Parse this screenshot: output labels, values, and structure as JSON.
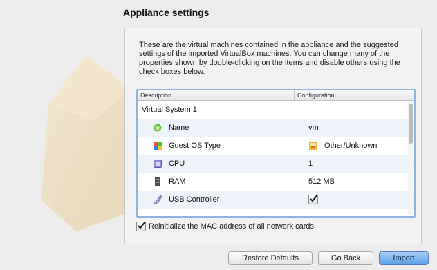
{
  "page": {
    "title": "Appliance settings",
    "description": "These are the virtual machines contained in the appliance and the suggested settings of the imported VirtualBox machines. You can change many of the properties shown by double-clicking on the items and disable others using the check boxes below."
  },
  "table": {
    "columns": [
      "Description",
      "Configuration"
    ],
    "system": "Virtual System 1",
    "rows": [
      {
        "icon": "name-icon",
        "label": "Name",
        "value": "vm"
      },
      {
        "icon": "guest-os-icon",
        "label": "Guest OS Type",
        "value": "Other/Unknown",
        "value_icon": "os-unknown-icon"
      },
      {
        "icon": "cpu-icon",
        "label": "CPU",
        "value": "1"
      },
      {
        "icon": "ram-icon",
        "label": "RAM",
        "value": "512 MB"
      },
      {
        "icon": "usb-icon",
        "label": "USB Controller",
        "checked": true
      }
    ]
  },
  "options": {
    "reinit_mac": {
      "label": "Reinitialize the MAC address of all network cards",
      "checked": true
    }
  },
  "buttons": {
    "restore": "Restore Defaults",
    "back": "Go Back",
    "import": "Import"
  },
  "colors": {
    "accent": "#5b9fe6",
    "table_border": "#8eb4e3"
  }
}
